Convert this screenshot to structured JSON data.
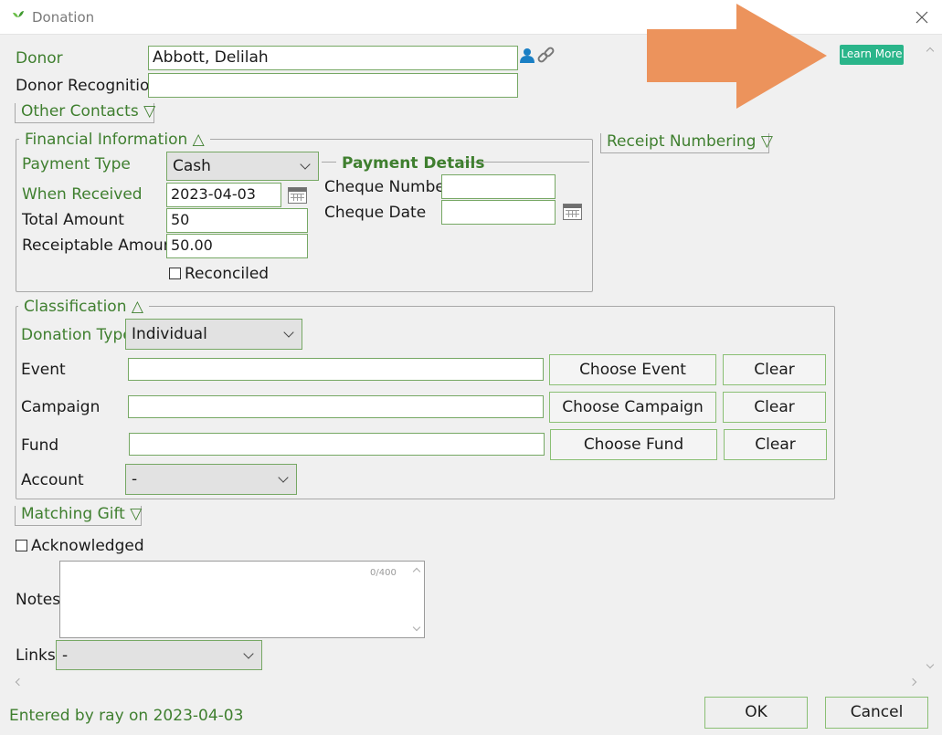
{
  "window": {
    "title": "Donation"
  },
  "header": {
    "learn_more": "Learn More"
  },
  "donor": {
    "label": "Donor",
    "value": "Abbott, Delilah",
    "recognition_label": "Donor Recognition",
    "recognition_value": ""
  },
  "other_contacts": {
    "label": "Other Contacts ▽"
  },
  "receipt_numbering": {
    "label": "Receipt Numbering ▽"
  },
  "financial": {
    "legend": "Financial Information △",
    "payment_type_label": "Payment Type",
    "payment_type_value": "Cash",
    "when_received_label": "When Received",
    "when_received_value": "2023-04-03",
    "total_label": "Total Amount",
    "total_value": "50",
    "receiptable_label": "Receiptable Amount",
    "receiptable_value": "50.00",
    "reconciled_label": "Reconciled"
  },
  "payment_details": {
    "legend": "Payment Details",
    "cheque_number_label": "Cheque Number",
    "cheque_number_value": "",
    "cheque_date_label": "Cheque Date",
    "cheque_date_value": ""
  },
  "classification": {
    "legend": "Classification △",
    "donation_type_label": "Donation Type",
    "donation_type_value": "Individual",
    "event_label": "Event",
    "choose_event": "Choose Event",
    "campaign_label": "Campaign",
    "choose_campaign": "Choose Campaign",
    "fund_label": "Fund",
    "choose_fund": "Choose Fund",
    "clear": "Clear",
    "account_label": "Account",
    "account_value": "-"
  },
  "matching_gift": {
    "label": "Matching Gift ▽"
  },
  "acknowledged": {
    "label": "Acknowledged"
  },
  "notes": {
    "label": "Notes",
    "counter": "0/400",
    "value": ""
  },
  "links": {
    "label": "Links",
    "value": "-"
  },
  "footer": {
    "entered_by": "Entered by ray on 2023-04-03",
    "ok": "OK",
    "cancel": "Cancel"
  },
  "icons": {
    "app": "leaf-icon",
    "close": "close-icon",
    "person": "person-icon",
    "link": "link-icon",
    "calendar": "calendar-icon",
    "arrow": "arrow-annotation"
  },
  "colors": {
    "accent_green": "#3f7f2f",
    "learn_more_bg": "#2ab58a",
    "arrow": "#ec935c"
  }
}
